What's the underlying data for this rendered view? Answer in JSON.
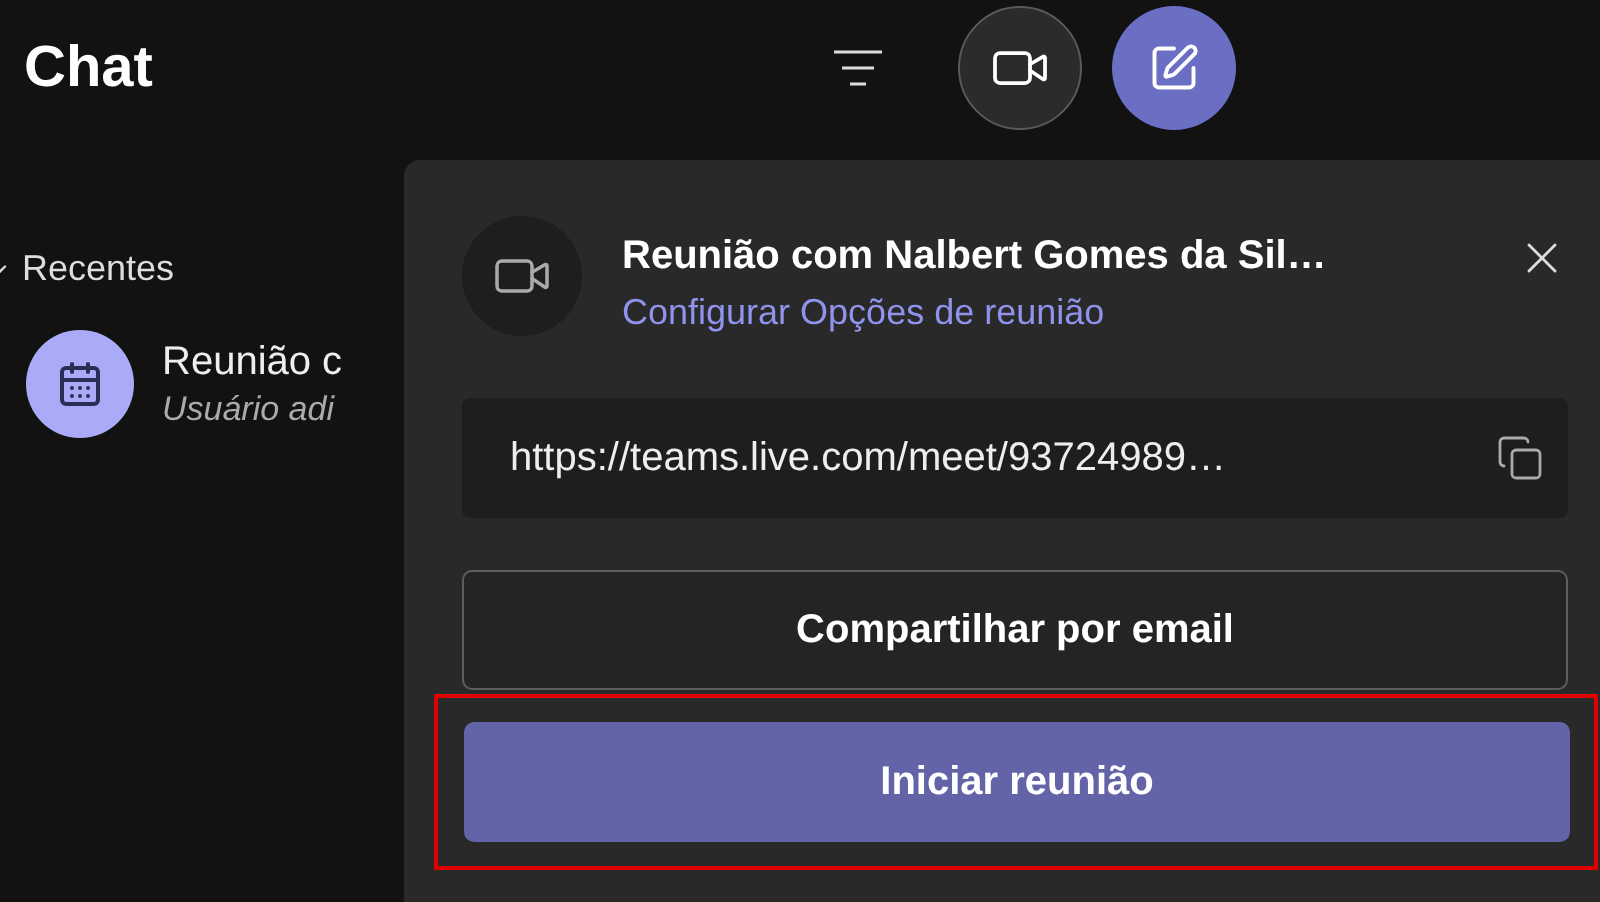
{
  "header": {
    "title": "Chat"
  },
  "sidebar": {
    "section": "Recentes",
    "expanded": true,
    "items": [
      {
        "title": "Reunião c",
        "subtitle": "Usuário adi"
      }
    ]
  },
  "popup": {
    "title": "Reunião com Nalbert Gomes da Sil…",
    "link": "Configurar Opções de reunião",
    "url": "https://teams.live.com/meet/93724989…",
    "buttons": [
      {
        "label": "Compartilhar por email",
        "kind": "secondary",
        "highlighted": false
      },
      {
        "label": "Iniciar reunião",
        "kind": "primary",
        "highlighted": true
      }
    ]
  }
}
